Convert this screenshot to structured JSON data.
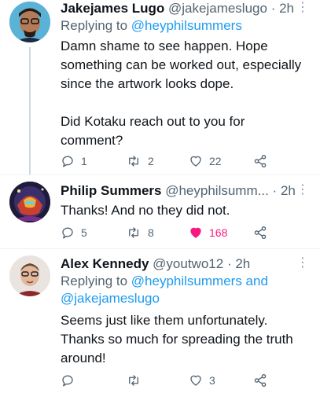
{
  "tweets": [
    {
      "name": "Jakejames Lugo",
      "handle": "@jakejameslugo",
      "separator": "·",
      "time": "2h",
      "reply_prefix": "Replying to",
      "reply_mentions": "@heyphilsummers",
      "text": "Damn shame to see happen. Hope\nsomething can be worked out, especially\nsince the artwork looks dope.\n\nDid Kotaku reach out to you for\ncomment?",
      "replies": "1",
      "retweets": "2",
      "likes": "22",
      "liked": false
    },
    {
      "name": "Philip Summers",
      "handle": "@heyphilsumm...",
      "separator": "·",
      "time": "2h",
      "text": "Thanks! And no they did not.",
      "replies": "5",
      "retweets": "8",
      "likes": "168",
      "liked": true,
      "like_color": "#f91880"
    },
    {
      "name": "Alex Kennedy",
      "handle": "@youtwo12",
      "separator": "·",
      "time": "2h",
      "reply_prefix": "Replying to",
      "reply_mentions_line1": "@heyphilsummers and",
      "reply_mentions_line2": "@jakejameslugo",
      "text": "Seems just like them unfortunately.\nThanks so much for spreading the truth\naround!",
      "replies": "",
      "retweets": "",
      "likes": "3",
      "liked": false
    }
  ],
  "more_icon": "⋮",
  "colors": {
    "link": "#1d9bf0",
    "secondary": "#536471",
    "like_active": "#f91880"
  },
  "icons": [
    "reply-icon",
    "retweet-icon",
    "like-icon",
    "share-icon",
    "more-icon"
  ]
}
